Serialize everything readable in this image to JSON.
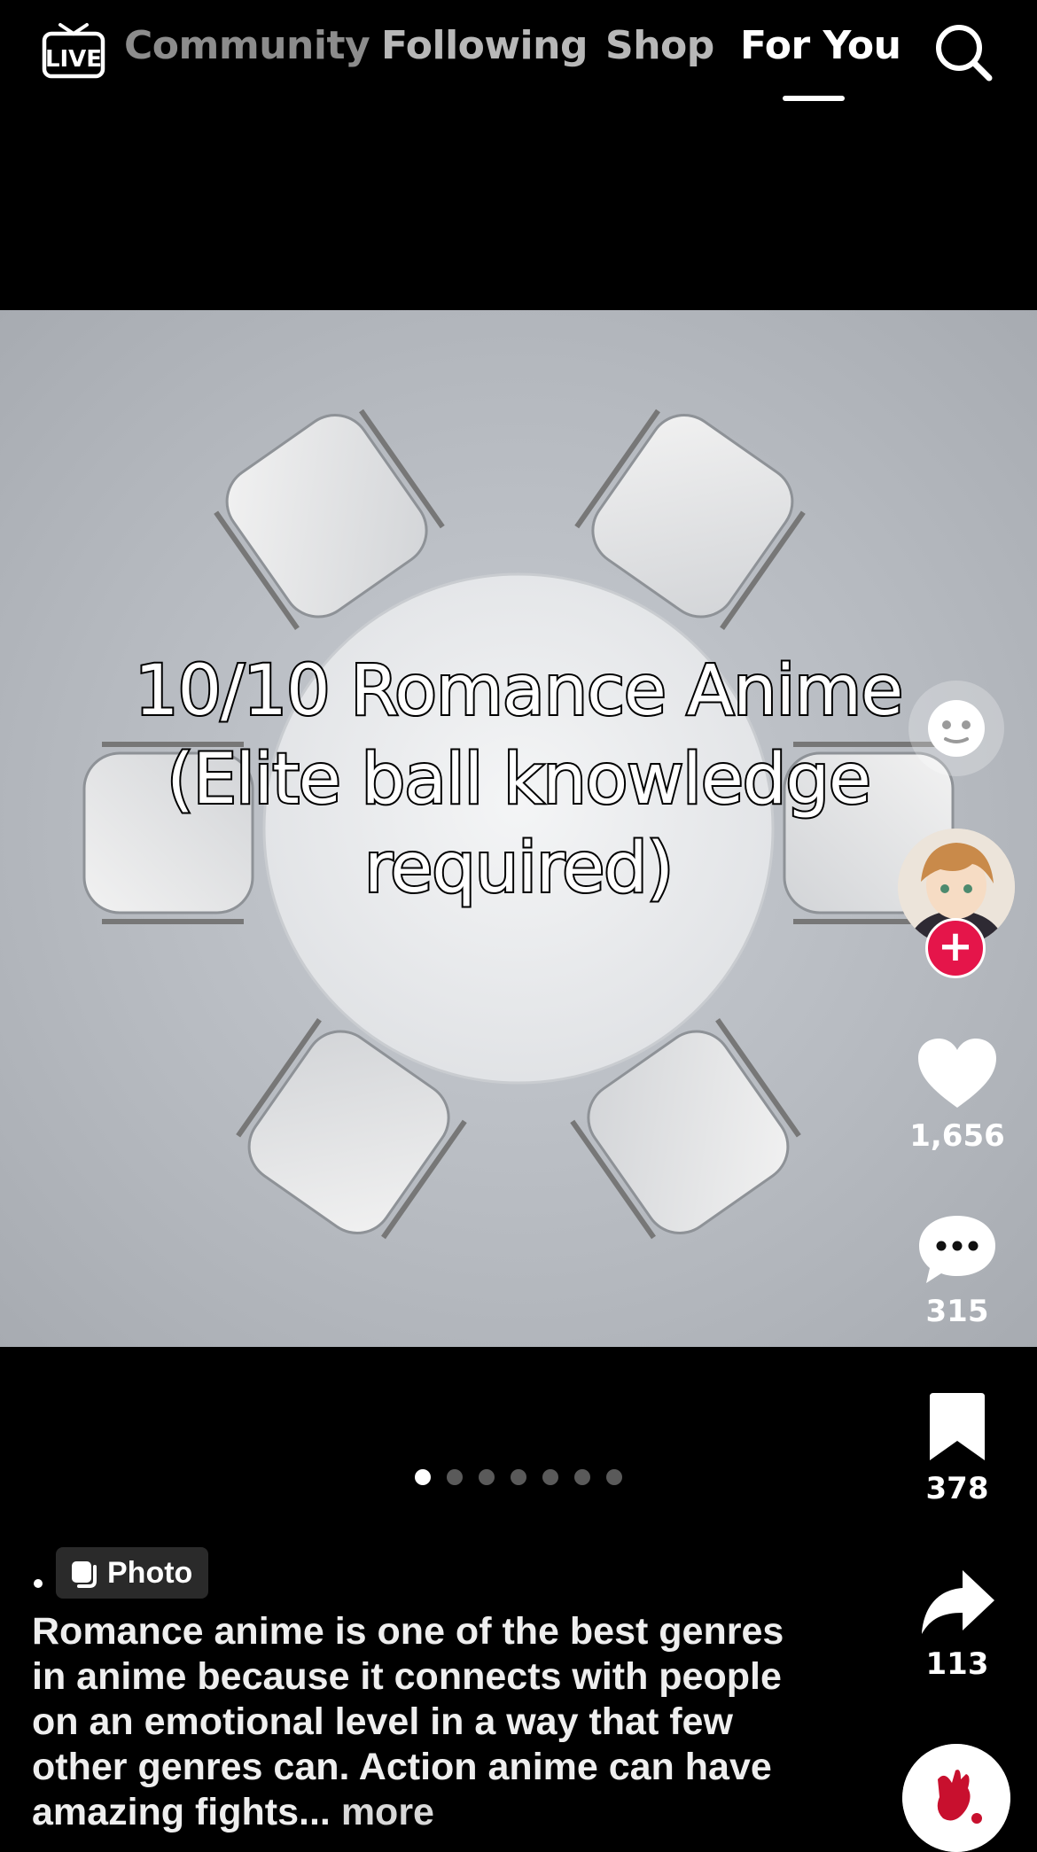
{
  "nav": {
    "tabs": [
      "Community",
      "Following",
      "Shop",
      "For You"
    ],
    "active_tab": "For You",
    "live_label": "LIVE"
  },
  "post": {
    "overlay_title_lines": [
      "10/10 Romance Anime",
      "(Elite ball knowledge",
      "required)"
    ],
    "carousel": {
      "total": 7,
      "active": 1
    },
    "badge": "Photo",
    "caption": "Romance anime is one of the best genres in anime because it connects with people on an emotional level in a way that few other genres can. Action anime can have amazing fights...",
    "more_label": "more"
  },
  "actions": {
    "likes": "1,656",
    "comments": "315",
    "saves": "378",
    "shares": "113"
  },
  "colors": {
    "background": "#000000",
    "follow_accent": "#e5154a",
    "text": "#ffffff"
  },
  "icons": [
    "live-icon",
    "search-icon",
    "effect-face-icon",
    "heart-icon",
    "comment-icon",
    "bookmark-icon",
    "share-icon",
    "music-disc-icon"
  ]
}
